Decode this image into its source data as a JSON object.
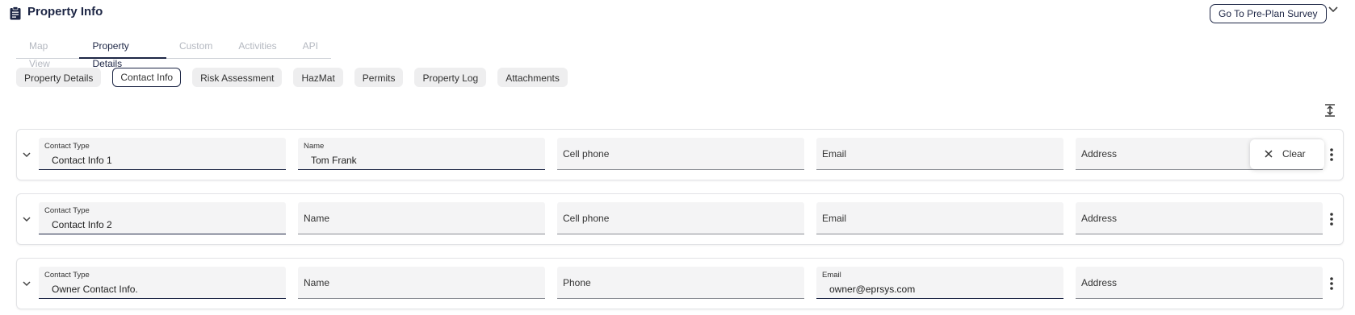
{
  "header": {
    "title": "Property Info",
    "preplan_label": "Go To Pre-Plan Survey"
  },
  "tabs": [
    {
      "label": "Map View",
      "active": false
    },
    {
      "label": "Property Details",
      "active": true
    },
    {
      "label": "Custom",
      "active": false
    },
    {
      "label": "Activities",
      "active": false
    },
    {
      "label": "API",
      "active": false
    }
  ],
  "subtabs": [
    {
      "label": "Property Details",
      "active": false
    },
    {
      "label": "Contact Info",
      "active": true
    },
    {
      "label": "Risk Assessment",
      "active": false
    },
    {
      "label": "HazMat",
      "active": false
    },
    {
      "label": "Permits",
      "active": false
    },
    {
      "label": "Property Log",
      "active": false
    },
    {
      "label": "Attachments",
      "active": false
    }
  ],
  "contacts": [
    {
      "type_label": "Contact Type",
      "type_value": "Contact Info 1",
      "name_label": "Name",
      "name_value": "Tom Frank",
      "phone_label": "Cell phone",
      "email_label": "Email",
      "address_label": "Address"
    },
    {
      "type_label": "Contact Type",
      "type_value": "Contact Info 2",
      "name_label": "Name",
      "phone_label": "Cell phone",
      "email_label": "Email",
      "address_label": "Address"
    },
    {
      "type_label": "Contact Type",
      "type_value": "Owner Contact Info.",
      "name_label": "Name",
      "phone_label": "Phone",
      "email_label": "Email",
      "email_value": "owner@eprsys.com",
      "address_label": "Address"
    }
  ],
  "menu": {
    "clear_label": "Clear"
  },
  "colors": {
    "accent": "#1d2645",
    "field_bg": "#f4f4f5",
    "chip_bg": "#eeeeef",
    "tab_inactive": "#b4b8c0"
  },
  "icons": [
    "clipboard-icon",
    "chevron-down-icon",
    "expand-vertical-icon",
    "kebab-menu-icon",
    "close-icon"
  ]
}
